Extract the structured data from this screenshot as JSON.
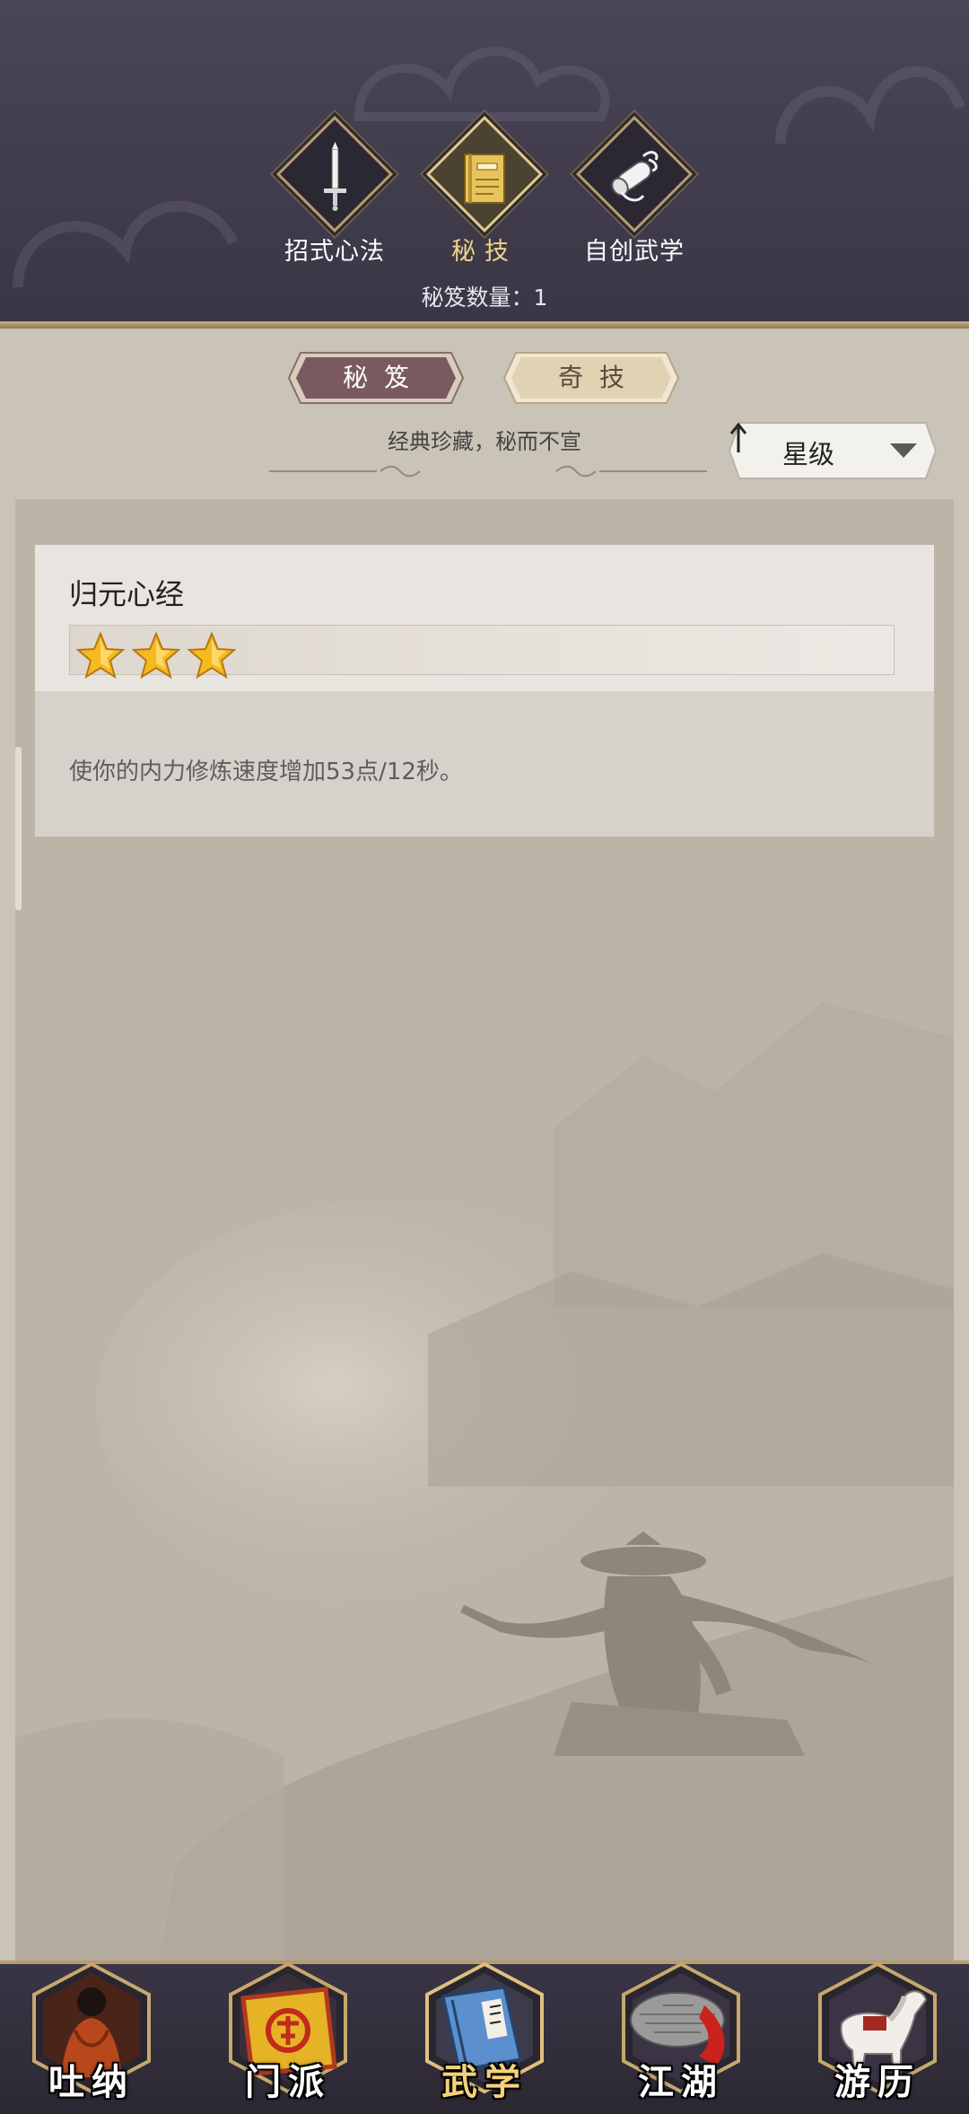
{
  "header": {
    "categories": [
      {
        "label": "招式心法",
        "icon": "sword-icon",
        "active": false
      },
      {
        "label": "秘技",
        "icon": "book-icon",
        "active": true
      },
      {
        "label": "自创武学",
        "icon": "scroll-icon",
        "active": false
      }
    ],
    "book_count": "秘笈数量：1"
  },
  "subtabs": [
    {
      "label": "秘笈",
      "active": true
    },
    {
      "label": "奇技",
      "active": false
    }
  ],
  "subtitle": "经典珍藏，秘而不宣",
  "sort": {
    "label": "星级",
    "direction": "ascending",
    "icon": "arrow-up-icon"
  },
  "cards": [
    {
      "title": "归元心经",
      "stars": 3,
      "description": "使你的内力修炼速度增加53点/12秒。"
    }
  ],
  "bottom_nav": [
    {
      "label": "吐纳",
      "icon": "monk-meditation-icon",
      "active": false
    },
    {
      "label": "门派",
      "icon": "sect-banner-icon",
      "active": false
    },
    {
      "label": "武学",
      "icon": "martial-book-icon",
      "active": true
    },
    {
      "label": "江湖",
      "icon": "bamboo-hat-icon",
      "active": false
    },
    {
      "label": "游历",
      "icon": "horse-icon",
      "active": false
    }
  ],
  "colors": {
    "header_bg": "#433f4f",
    "gold_accent": "#f0d486",
    "active_subtab": "#7a5a5e",
    "inactive_subtab": "#e4d6b9",
    "panel_bg": "#bdb4a8",
    "star": "#f6b921"
  }
}
